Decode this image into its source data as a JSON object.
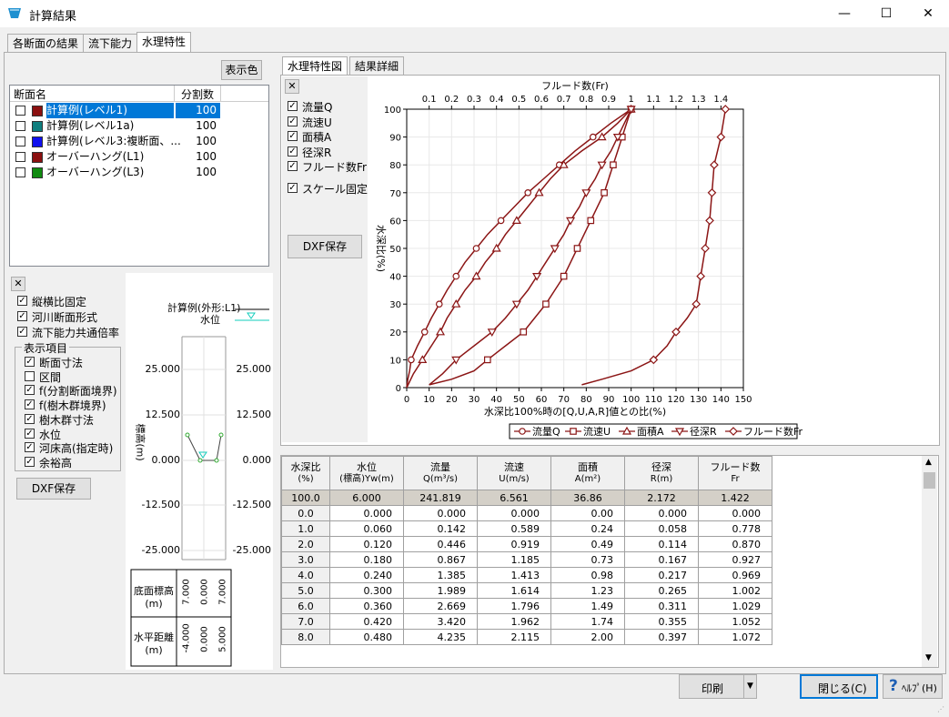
{
  "window": {
    "title": "計算結果",
    "min": "—",
    "max": "☐",
    "close": "✕"
  },
  "tabs": [
    "各断面の結果",
    "流下能力",
    "水理特性"
  ],
  "left": {
    "color_button": "表示色",
    "list_headers": [
      "断面名",
      "分割数"
    ],
    "sections": [
      {
        "name": "計算例(レベル1)",
        "count": "100",
        "color": "#8b1010",
        "selected": true
      },
      {
        "name": "計算例(レベル1a)",
        "count": "100",
        "color": "#0f7f7f",
        "selected": false
      },
      {
        "name": "計算例(レベル3:複断面、...",
        "count": "100",
        "color": "#1010ee",
        "selected": false
      },
      {
        "name": "オーバーハング(L1)",
        "count": "100",
        "color": "#8b1010",
        "selected": false
      },
      {
        "name": "オーバーハング(L3)",
        "count": "100",
        "color": "#108b10",
        "selected": false
      }
    ],
    "options": [
      {
        "label": "縦横比固定",
        "checked": true
      },
      {
        "label": "河川断面形式",
        "checked": true
      },
      {
        "label": "流下能力共通倍率",
        "checked": true
      }
    ],
    "group_title": "表示項目",
    "group_items": [
      {
        "label": "断面寸法",
        "checked": true
      },
      {
        "label": "区間",
        "checked": false
      },
      {
        "label": "f(分割断面境界)",
        "checked": true
      },
      {
        "label": "f(樹木群境界)",
        "checked": true
      },
      {
        "label": "樹木群寸法",
        "checked": true
      },
      {
        "label": "水位",
        "checked": true
      },
      {
        "label": "河床高(指定時)",
        "checked": true
      },
      {
        "label": "余裕高",
        "checked": true
      }
    ],
    "dxf_button": "DXF保存",
    "close_x": "✕",
    "mini": {
      "legend_name": "計算例(外形:L1)",
      "legend_wl": "水位",
      "ylabel": "標高(m)",
      "left_ticks": [
        "25.000",
        "12.500",
        "0.000",
        "-12.500",
        "-25.000"
      ],
      "right_ticks": [
        "25.000",
        "12.500",
        "0.000",
        "-12.500",
        "-25.000"
      ],
      "bottom_row1_label": "底面標高\n(m)",
      "bottom_row1_vals": [
        "7.000",
        "0.000",
        "7.000"
      ],
      "bottom_row2_label": "水平距離\n(m)",
      "bottom_row2_vals": [
        "-4.000",
        "0.000",
        "5.000"
      ]
    }
  },
  "right": {
    "tabs": [
      "水理特性図",
      "結果詳細"
    ],
    "close_x": "✕",
    "checks": [
      {
        "label": "流量Q",
        "checked": true
      },
      {
        "label": "流速U",
        "checked": true
      },
      {
        "label": "面積A",
        "checked": true
      },
      {
        "label": "径深R",
        "checked": true
      },
      {
        "label": "フルード数Fr",
        "checked": true
      }
    ],
    "scale_fixed": {
      "label": "スケール固定",
      "checked": true
    },
    "dxf_button": "DXF保存"
  },
  "chart_data": {
    "type": "line",
    "top_label": "フルード数(Fr)",
    "xlabel": "水深比100%時の[Q,U,A,R]値との比(%)",
    "ylabel": "水深比(%)",
    "x_ticks": [
      "0",
      "10",
      "20",
      "30",
      "40",
      "50",
      "60",
      "70",
      "80",
      "90",
      "100",
      "110",
      "120",
      "130",
      "140",
      "150"
    ],
    "y_ticks": [
      "0",
      "10",
      "20",
      "30",
      "40",
      "50",
      "60",
      "70",
      "80",
      "90",
      "100"
    ],
    "top_ticks": [
      "0.1",
      "0.2",
      "0.3",
      "0.4",
      "0.5",
      "0.6",
      "0.7",
      "0.8",
      "0.9",
      "1",
      "1.1",
      "1.2",
      "1.3",
      "1.4"
    ],
    "xlim": [
      0,
      150
    ],
    "ylim": [
      0,
      100
    ],
    "top_lim": [
      0,
      1.5
    ],
    "color": "#8b1515",
    "series": [
      {
        "name": "流量Q",
        "marker": "circle",
        "points": [
          [
            2,
            10
          ],
          [
            8,
            20
          ],
          [
            14.5,
            30
          ],
          [
            22,
            40
          ],
          [
            31,
            50
          ],
          [
            42,
            60
          ],
          [
            54,
            70
          ],
          [
            68,
            80
          ],
          [
            83,
            90
          ],
          [
            100,
            100
          ]
        ],
        "curve": [
          [
            0,
            0
          ],
          [
            0.5,
            3
          ],
          [
            1.3,
            6
          ],
          [
            2,
            10
          ],
          [
            4.8,
            15
          ],
          [
            8,
            20
          ],
          [
            11,
            25
          ],
          [
            14.5,
            30
          ],
          [
            18,
            35
          ],
          [
            22,
            40
          ],
          [
            26,
            45
          ],
          [
            31,
            50
          ],
          [
            36,
            55
          ],
          [
            42,
            60
          ],
          [
            48,
            65
          ],
          [
            54,
            70
          ],
          [
            61,
            75
          ],
          [
            68,
            80
          ],
          [
            75,
            85
          ],
          [
            83,
            90
          ],
          [
            91,
            95
          ],
          [
            100,
            100
          ]
        ]
      },
      {
        "name": "流速U",
        "marker": "square",
        "points": [
          [
            36,
            10
          ],
          [
            52,
            20
          ],
          [
            62,
            30
          ],
          [
            70,
            40
          ],
          [
            76,
            50
          ],
          [
            82,
            60
          ],
          [
            88,
            70
          ],
          [
            92,
            80
          ],
          [
            96,
            90
          ],
          [
            100,
            100
          ]
        ],
        "curve": [
          [
            10,
            1
          ],
          [
            20,
            3
          ],
          [
            30,
            6
          ],
          [
            36,
            10
          ],
          [
            44,
            15
          ],
          [
            52,
            20
          ],
          [
            57,
            25
          ],
          [
            62,
            30
          ],
          [
            66,
            35
          ],
          [
            70,
            40
          ],
          [
            73,
            45
          ],
          [
            76,
            50
          ],
          [
            79,
            55
          ],
          [
            82,
            60
          ],
          [
            85,
            65
          ],
          [
            88,
            70
          ],
          [
            90,
            75
          ],
          [
            92,
            80
          ],
          [
            94,
            85
          ],
          [
            96,
            90
          ],
          [
            98,
            95
          ],
          [
            100,
            100
          ]
        ]
      },
      {
        "name": "面積A",
        "marker": "triangle",
        "points": [
          [
            7,
            10
          ],
          [
            15,
            20
          ],
          [
            22,
            30
          ],
          [
            31,
            40
          ],
          [
            40,
            50
          ],
          [
            49,
            60
          ],
          [
            59,
            70
          ],
          [
            70,
            80
          ],
          [
            87,
            90
          ],
          [
            100,
            100
          ]
        ],
        "curve": [
          [
            0,
            0
          ],
          [
            3,
            5
          ],
          [
            7,
            10
          ],
          [
            11,
            15
          ],
          [
            15,
            20
          ],
          [
            18,
            25
          ],
          [
            22,
            30
          ],
          [
            26,
            35
          ],
          [
            31,
            40
          ],
          [
            35,
            45
          ],
          [
            40,
            50
          ],
          [
            44,
            55
          ],
          [
            49,
            60
          ],
          [
            54,
            65
          ],
          [
            59,
            70
          ],
          [
            64,
            75
          ],
          [
            70,
            80
          ],
          [
            78,
            85
          ],
          [
            87,
            90
          ],
          [
            94,
            95
          ],
          [
            100,
            100
          ]
        ]
      },
      {
        "name": "径深R",
        "marker": "inv-triangle",
        "points": [
          [
            22,
            10
          ],
          [
            38,
            20
          ],
          [
            49,
            30
          ],
          [
            58,
            40
          ],
          [
            66,
            50
          ],
          [
            73,
            60
          ],
          [
            80,
            70
          ],
          [
            87,
            80
          ],
          [
            94,
            90
          ],
          [
            100,
            100
          ]
        ],
        "curve": [
          [
            10,
            1
          ],
          [
            16,
            5
          ],
          [
            22,
            10
          ],
          [
            30,
            15
          ],
          [
            38,
            20
          ],
          [
            44,
            25
          ],
          [
            49,
            30
          ],
          [
            54,
            35
          ],
          [
            58,
            40
          ],
          [
            62,
            45
          ],
          [
            66,
            50
          ],
          [
            70,
            55
          ],
          [
            73,
            60
          ],
          [
            77,
            65
          ],
          [
            80,
            70
          ],
          [
            84,
            75
          ],
          [
            87,
            80
          ],
          [
            91,
            85
          ],
          [
            94,
            90
          ],
          [
            97,
            95
          ],
          [
            100,
            100
          ]
        ]
      },
      {
        "name": "フルード数Fr",
        "marker": "diamond",
        "axis": "top",
        "points": [
          [
            1.1,
            10
          ],
          [
            1.2,
            20
          ],
          [
            1.29,
            30
          ],
          [
            1.31,
            40
          ],
          [
            1.33,
            50
          ],
          [
            1.35,
            60
          ],
          [
            1.36,
            70
          ],
          [
            1.37,
            80
          ],
          [
            1.4,
            90
          ],
          [
            1.42,
            100
          ]
        ],
        "curve": [
          [
            0.78,
            1
          ],
          [
            0.87,
            3
          ],
          [
            1.0,
            6
          ],
          [
            1.1,
            10
          ],
          [
            1.16,
            15
          ],
          [
            1.2,
            20
          ],
          [
            1.25,
            25
          ],
          [
            1.29,
            30
          ],
          [
            1.3,
            35
          ],
          [
            1.31,
            40
          ],
          [
            1.32,
            45
          ],
          [
            1.33,
            50
          ],
          [
            1.34,
            55
          ],
          [
            1.35,
            60
          ],
          [
            1.355,
            65
          ],
          [
            1.36,
            70
          ],
          [
            1.365,
            75
          ],
          [
            1.37,
            80
          ],
          [
            1.385,
            85
          ],
          [
            1.4,
            90
          ],
          [
            1.41,
            95
          ],
          [
            1.42,
            100
          ]
        ]
      }
    ],
    "legend": [
      "流量Q",
      "流速U",
      "面積A",
      "径深R",
      "フルード数Fr"
    ]
  },
  "table": {
    "headers": [
      [
        "水深比",
        "(%)"
      ],
      [
        "水位",
        "(標高)Yw(m)"
      ],
      [
        "流量",
        "Q(m³/s)"
      ],
      [
        "流速",
        "U(m/s)"
      ],
      [
        "面積",
        "A(m²)"
      ],
      [
        "径深",
        "R(m)"
      ],
      [
        "フルード数",
        "Fr"
      ]
    ],
    "highlight": [
      "100.0",
      "6.000",
      "241.819",
      "6.561",
      "36.86",
      "2.172",
      "1.422"
    ],
    "rows": [
      [
        "0.0",
        "0.000",
        "0.000",
        "0.000",
        "0.00",
        "0.000",
        "0.000"
      ],
      [
        "1.0",
        "0.060",
        "0.142",
        "0.589",
        "0.24",
        "0.058",
        "0.778"
      ],
      [
        "2.0",
        "0.120",
        "0.446",
        "0.919",
        "0.49",
        "0.114",
        "0.870"
      ],
      [
        "3.0",
        "0.180",
        "0.867",
        "1.185",
        "0.73",
        "0.167",
        "0.927"
      ],
      [
        "4.0",
        "0.240",
        "1.385",
        "1.413",
        "0.98",
        "0.217",
        "0.969"
      ],
      [
        "5.0",
        "0.300",
        "1.989",
        "1.614",
        "1.23",
        "0.265",
        "1.002"
      ],
      [
        "6.0",
        "0.360",
        "2.669",
        "1.796",
        "1.49",
        "0.311",
        "1.029"
      ],
      [
        "7.0",
        "0.420",
        "3.420",
        "1.962",
        "1.74",
        "0.355",
        "1.052"
      ],
      [
        "8.0",
        "0.480",
        "4.235",
        "2.115",
        "2.00",
        "0.397",
        "1.072"
      ]
    ]
  },
  "footer": {
    "print": "印刷",
    "close": "閉じる(C)",
    "help": "ﾍﾙﾌﾟ(H)"
  }
}
